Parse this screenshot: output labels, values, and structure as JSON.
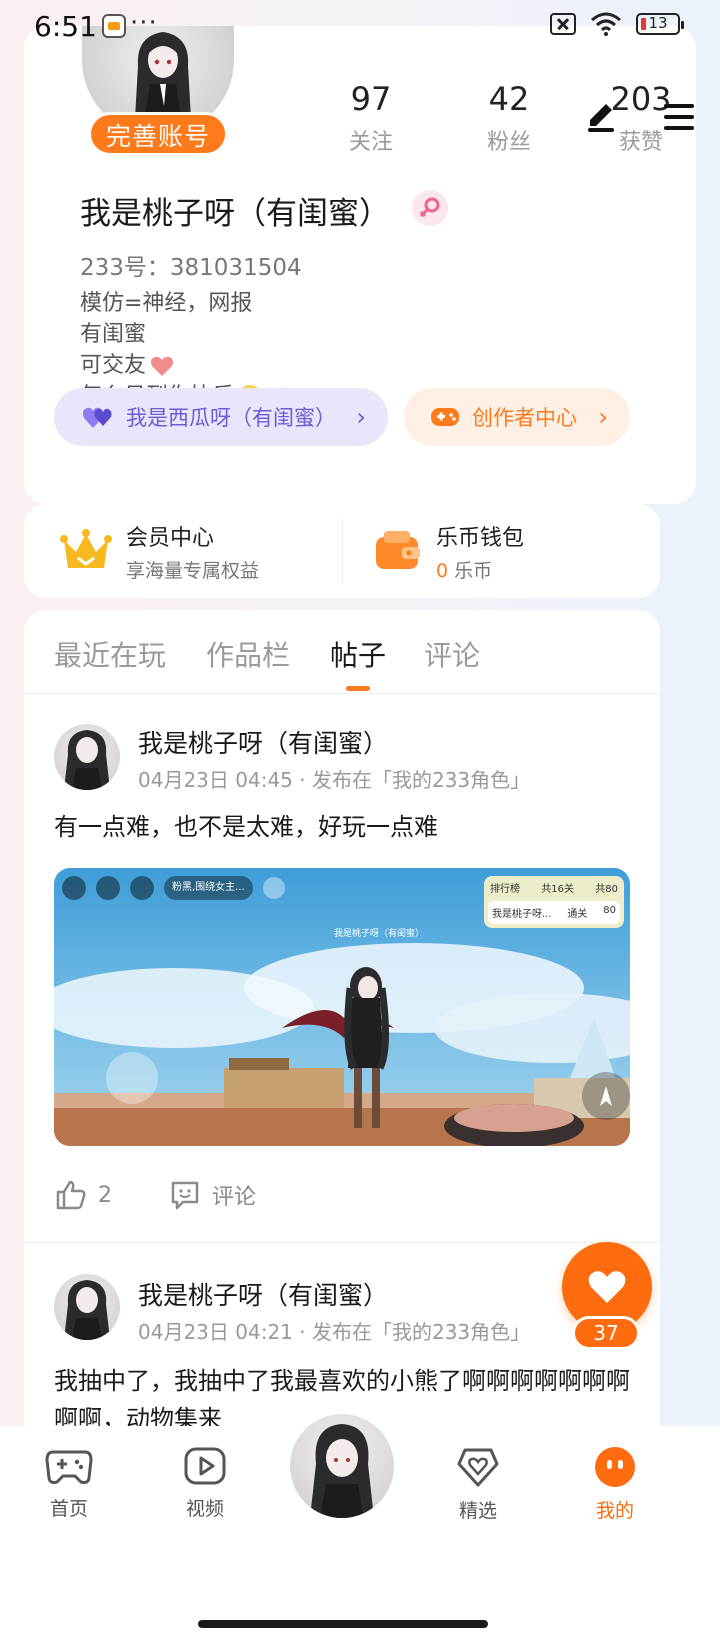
{
  "status_bar": {
    "time": "6:51",
    "dots": "···",
    "battery": "13"
  },
  "profile": {
    "complete_account": "完善账号",
    "stats": [
      {
        "value": "97",
        "label": "关注"
      },
      {
        "value": "42",
        "label": "粉丝"
      },
      {
        "value": "203",
        "label": "获赞"
      }
    ],
    "nickname": "我是桃子呀（有闺蜜）",
    "uid": "233号：381031504",
    "bio": [
      "模仿=神经，网报",
      "有闺蜜",
      "可交友",
      "怎么见到你快乐"
    ],
    "friend_pill": "我是西瓜呀（有闺蜜）",
    "creator_pill": "创作者中心"
  },
  "member": {
    "vip_title": "会员中心",
    "vip_sub": "享海量专属权益",
    "wallet_title": "乐币钱包",
    "wallet_amount": "0",
    "wallet_unit": "乐币"
  },
  "tabs": [
    "最近在玩",
    "作品栏",
    "帖子",
    "评论"
  ],
  "active_tab": "帖子",
  "posts": [
    {
      "author": "我是桃子呀（有闺蜜）",
      "meta": "04月23日 04:45 · 发布在「我的233角色」",
      "text": "有一点难，也不是太难，好玩一点难",
      "likes": "2",
      "comment_label": "评论",
      "game_overlay": {
        "chat_tag": "粉黑,围绕女主...",
        "rank_title": "排行榜",
        "rank_levels": "共16关",
        "rank_total": "共80",
        "rank_player": "我是桃子呀...",
        "rank_status": "通关",
        "rank_score": "80",
        "player_tag": "我是桃子呀（有闺蜜）"
      }
    },
    {
      "author": "我是桃子呀（有闺蜜）",
      "meta": "04月23日 04:21 · 发布在「我的233角色」",
      "text": "我抽中了，我抽中了我最喜欢的小熊了啊啊啊啊啊啊啊啊啊，动物集来"
    }
  ],
  "float_like_count": "37",
  "nav": [
    {
      "label": "首页",
      "icon": "gamepad-icon"
    },
    {
      "label": "视频",
      "icon": "play-icon"
    },
    {
      "label": "精选",
      "icon": "heart-shield-icon"
    },
    {
      "label": "我的",
      "icon": "profile-face-icon"
    }
  ],
  "colors": {
    "accent": "#ff7a1a",
    "purple": "#6a5cd6",
    "muted": "#9a9a9a"
  }
}
